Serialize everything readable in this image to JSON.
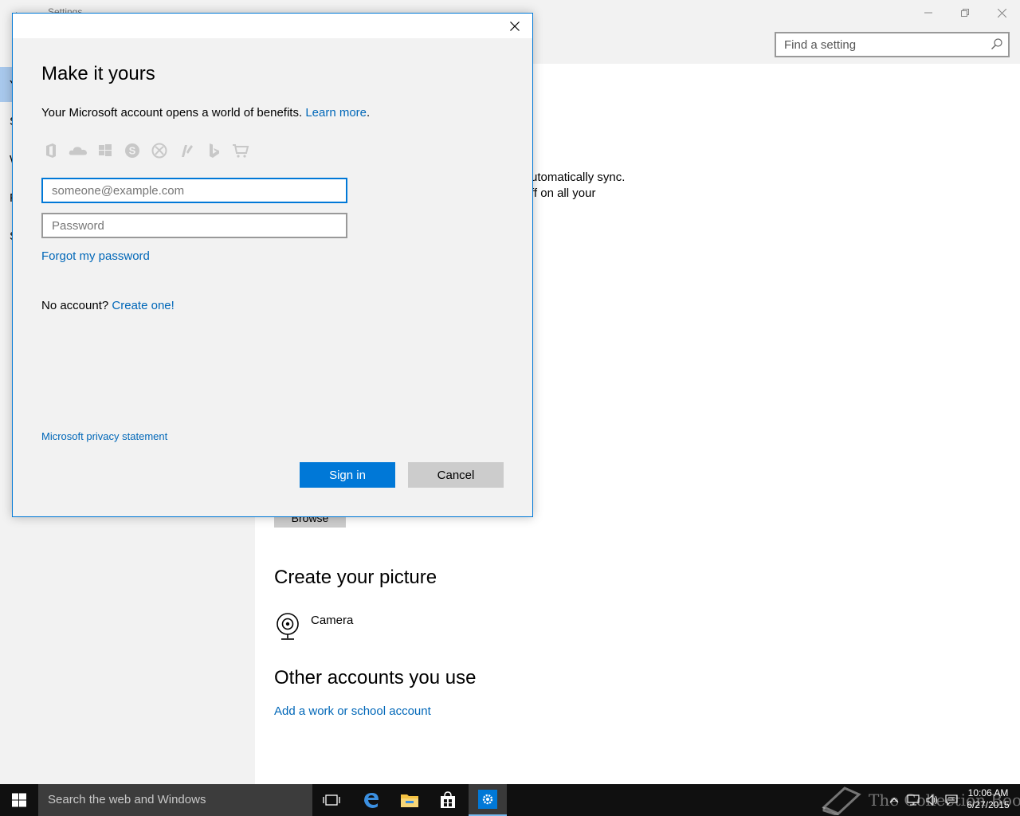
{
  "settings": {
    "app_title": "Settings",
    "search_placeholder": "Find a setting",
    "nav_initials": [
      "Y",
      "S",
      "W",
      "P",
      "S"
    ],
    "sync_text_1": "utomatically sync.",
    "sync_text_2": "ff on all your",
    "browse_label": "Browse",
    "create_picture_heading": "Create your picture",
    "camera_label": "Camera",
    "other_accounts_heading": "Other accounts you use",
    "add_work_account_link": "Add a work or school account"
  },
  "dialog": {
    "title": "Make it yours",
    "desc_text": "Your Microsoft account opens a world of benefits.",
    "learn_more": "Learn more",
    "desc_period": ".",
    "services": [
      "office-icon",
      "onedrive-icon",
      "windows-icon",
      "skype-icon",
      "xbox-icon",
      "msn-icon",
      "bing-icon",
      "store-icon"
    ],
    "email_placeholder": "someone@example.com",
    "password_placeholder": "Password",
    "forgot_link": "Forgot my password",
    "no_account_text": "No account?",
    "create_link": "Create one!",
    "privacy_link": "Microsoft privacy statement",
    "signin_label": "Sign in",
    "cancel_label": "Cancel"
  },
  "taskbar": {
    "search_placeholder": "Search the web and Windows",
    "watermark": "The Collection Book",
    "time": "10:06 AM",
    "date": "6/27/2015"
  },
  "colors": {
    "accent": "#0078d7",
    "link": "#0067b8",
    "nav_selected": "#a8c8ec",
    "taskbar": "#101010"
  }
}
